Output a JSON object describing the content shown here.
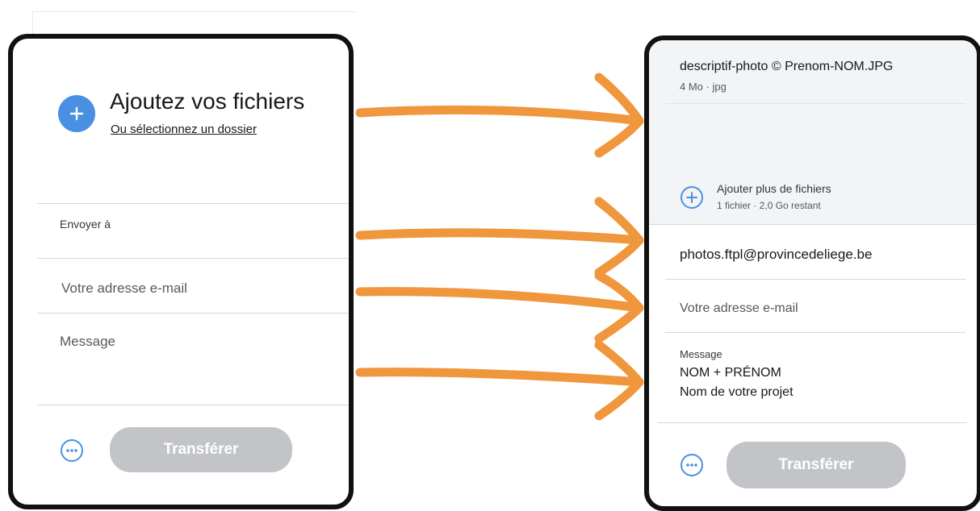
{
  "colors": {
    "accent": "#4a90e2",
    "arrow": "#f0963c",
    "button_disabled": "#c2c4c7",
    "panel_border": "#111111"
  },
  "left": {
    "add_files_title": "Ajoutez vos fichiers",
    "select_folder_link": "Ou sélectionnez un dossier",
    "send_to_label": "Envoyer à",
    "email_placeholder": "Votre adresse e-mail",
    "message_placeholder": "Message",
    "transfer_label": "Transférer",
    "icons": {
      "add": "plus-circle-icon",
      "more": "more-options-icon"
    }
  },
  "right": {
    "file": {
      "name": "descriptif-photo © Prenom-NOM.JPG",
      "meta": "4 Mo · jpg"
    },
    "add_more_title": "Ajouter plus de fichiers",
    "add_more_meta": "1 fichier · 2,0 Go restant",
    "recipient": "photos.ftpl@provincedeliege.be",
    "email_placeholder": "Votre adresse e-mail",
    "message_label": "Message",
    "message_lines": [
      "NOM + PRÉNOM",
      "Nom de votre projet"
    ],
    "transfer_label": "Transférer",
    "icons": {
      "add_more": "plus-circle-outline-icon",
      "more": "more-options-icon"
    }
  }
}
